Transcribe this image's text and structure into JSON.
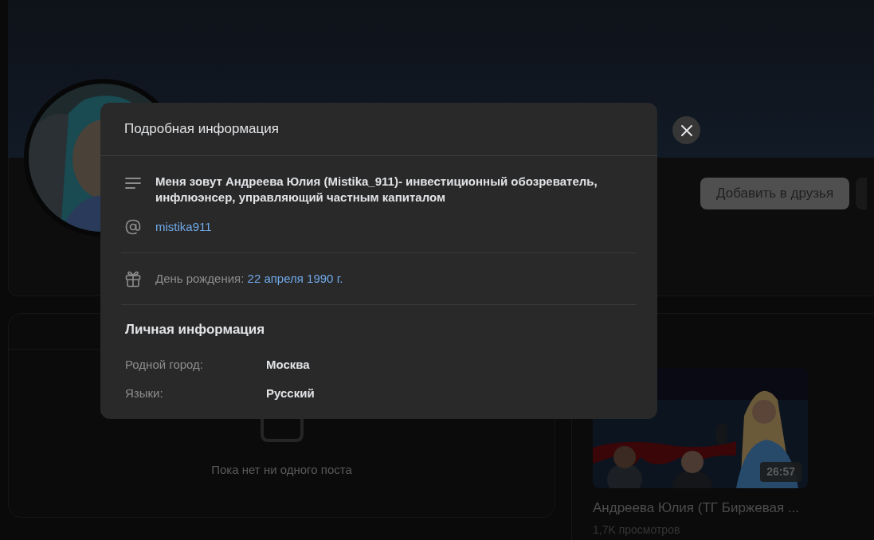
{
  "profile": {
    "add_friend_button": "Добавить в друзья"
  },
  "posts": {
    "empty_text": "Пока нет ни одного поста"
  },
  "videos": [
    {
      "duration": "26:57",
      "title": "Андреева Юлия (ТГ Биржевая ...",
      "views": "1,7K просмотров"
    }
  ],
  "modal": {
    "title": "Подробная информация",
    "about": "Меня зовут Андреева Юлия (Mistika_911)- инвестиционный обозреватель, инфлюэнсер, управляющий частным капиталом",
    "username": "mistika911",
    "birthday_label": "День рождения:",
    "birthday_value": "22 апреля 1990 г.",
    "personal_heading": "Личная информация",
    "personal": [
      {
        "label": "Родной город:",
        "value": "Москва"
      },
      {
        "label": "Языки:",
        "value": "Русский"
      }
    ]
  }
}
